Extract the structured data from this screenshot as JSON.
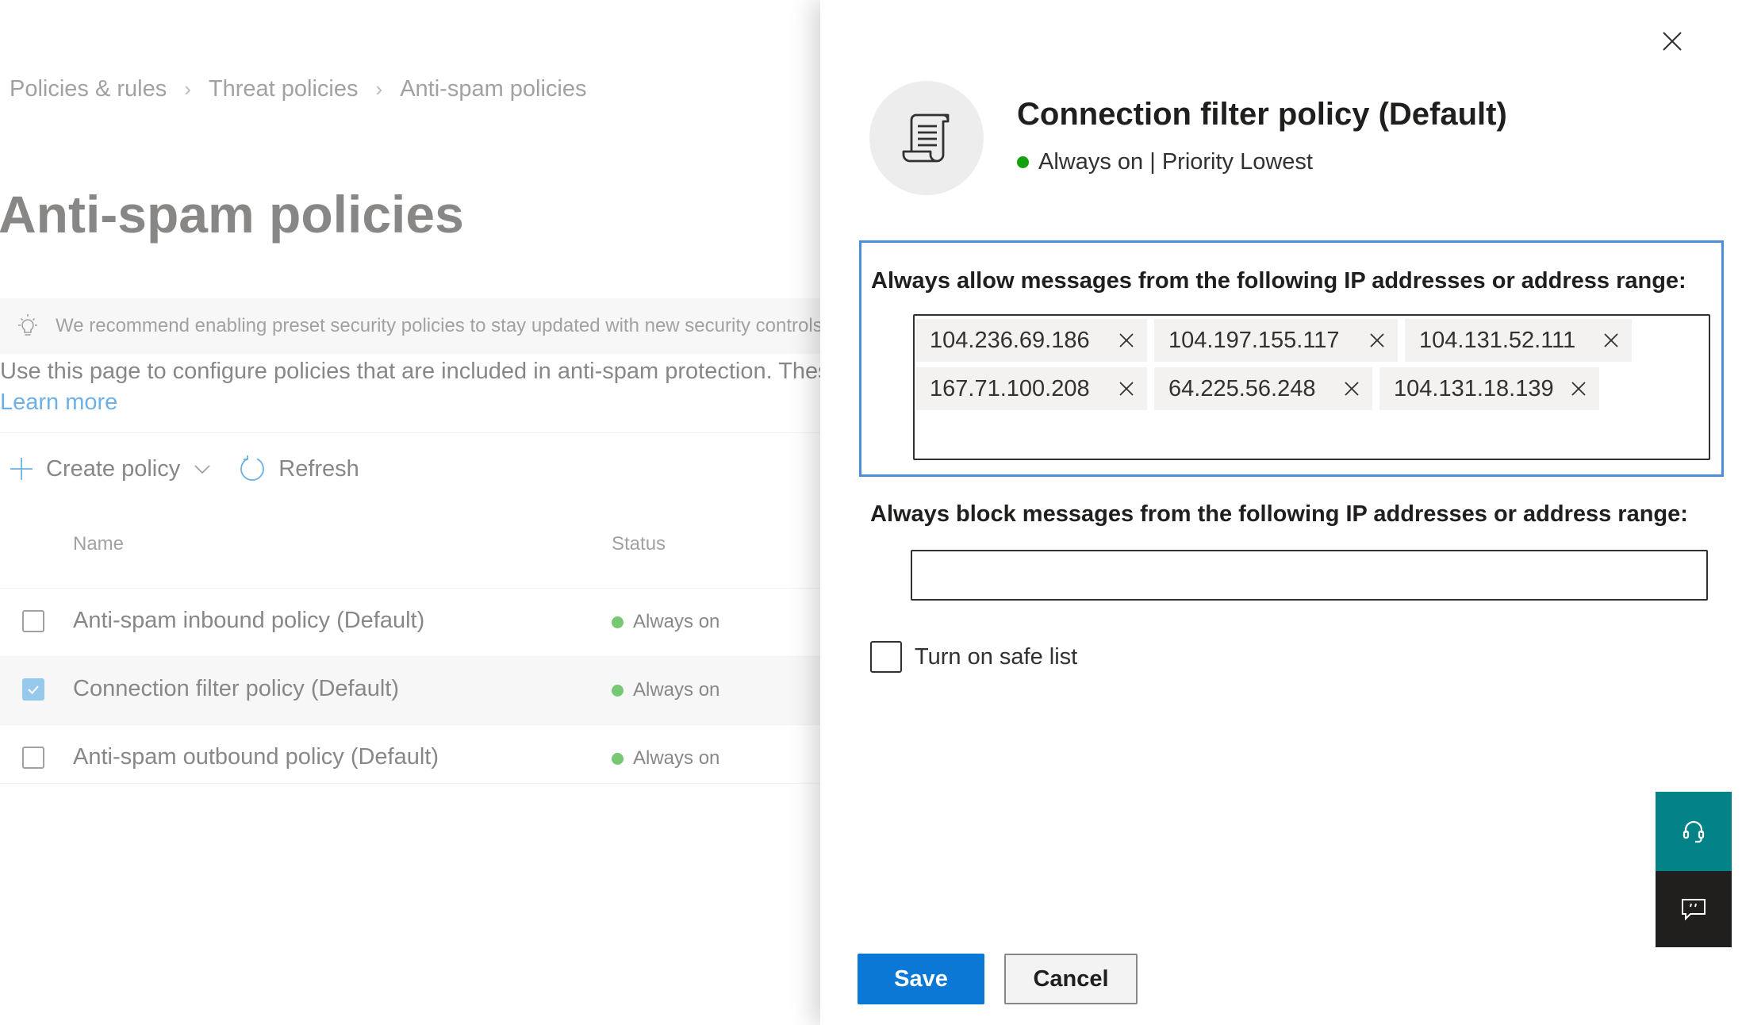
{
  "breadcrumb": {
    "items": [
      "Policies & rules",
      "Threat policies",
      "Anti-spam policies"
    ],
    "separator": ">"
  },
  "page": {
    "title": "Anti-spam policies",
    "banner": "We recommend enabling preset security policies to stay updated with new security controls",
    "description": "Use this page to configure policies that are included in anti-spam protection. These p",
    "learn_more": "Learn more"
  },
  "commands": {
    "create_policy": "Create policy",
    "refresh": "Refresh"
  },
  "table": {
    "headers": {
      "name": "Name",
      "status": "Status"
    },
    "rows": [
      {
        "name": "Anti-spam inbound policy (Default)",
        "status": "Always on",
        "checked": false
      },
      {
        "name": "Connection filter policy (Default)",
        "status": "Always on",
        "checked": true
      },
      {
        "name": "Anti-spam outbound policy (Default)",
        "status": "Always on",
        "checked": false
      }
    ]
  },
  "panel": {
    "title": "Connection filter policy (Default)",
    "subtitle": "Always on | Priority Lowest",
    "allow_label": "Always allow messages from the following IP addresses or address range:",
    "allow_ips": [
      [
        "104.236.69.186",
        "104.197.155.117",
        "104.131.52.111"
      ],
      [
        "167.71.100.208",
        "64.225.56.248",
        "104.131.18.139"
      ]
    ],
    "block_label": "Always block messages from the following IP addresses or address range:",
    "block_value": "",
    "safe_list_label": "Turn on safe list",
    "safe_list_checked": false,
    "save": "Save",
    "cancel": "Cancel"
  },
  "icons": {
    "close": "close-icon",
    "policy": "scroll-icon",
    "help": "headset-icon",
    "feedback": "feedback-icon"
  },
  "colors": {
    "accent": "#0a78d4",
    "status_green": "#13a10e",
    "focus_border": "#4a8fd9",
    "help_fab": "#038387",
    "feedback_fab": "#201f1e"
  }
}
